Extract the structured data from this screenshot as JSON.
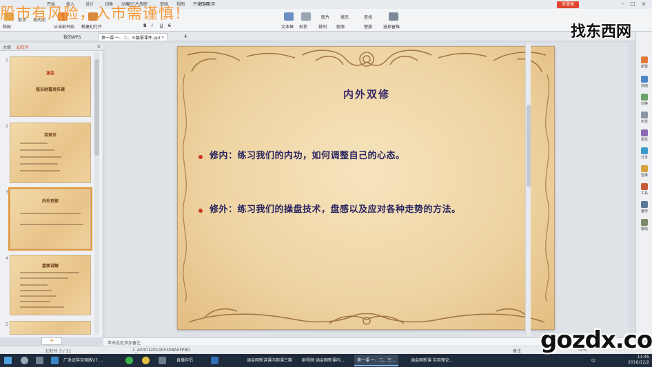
{
  "app": {
    "name": "WPS 演示",
    "login_label": "未登录"
  },
  "ribbon": {
    "tabs": [
      "开始",
      "插入",
      "设计",
      "切换",
      "动画",
      "幻灯片放映",
      "审阅",
      "视图",
      "开发工具",
      "特色应用"
    ],
    "buttons": {
      "paste": "粘贴",
      "cut": "剪切",
      "format_painter": "格式刷",
      "from_current": "从当前开始",
      "new_slide": "新建幻灯片",
      "font_bold": "B",
      "font_italic": "I",
      "font_underline": "U",
      "font_strike": "S",
      "textbox": "文本框",
      "shape": "形状",
      "arrange": "排列",
      "outline": "轮廓",
      "picture": "图片",
      "fill": "填充",
      "find": "查找",
      "replace": "替换",
      "select_pane": "选择窗格"
    }
  },
  "doc_tabs": [
    {
      "label": "我的WPS",
      "active": false
    },
    {
      "label": "第一课 一、二、三篇幂课件.ppt *",
      "active": true
    }
  ],
  "left_panel": {
    "tabs": [
      {
        "label": "大纲",
        "active": false
      },
      {
        "label": "幻灯片",
        "active": true
      }
    ],
    "thumbs": [
      {
        "num": "1",
        "title": "涵金",
        "subtitle": "涨乐财富发布课"
      },
      {
        "num": "2",
        "title": "目录页"
      },
      {
        "num": "3",
        "title": "内外双修"
      },
      {
        "num": "4",
        "title": "盘面讲解"
      },
      {
        "num": "5",
        "title": ""
      }
    ]
  },
  "slide": {
    "title": "内外双修",
    "bullets": [
      "修内：练习我们的内功，如何调整自己的心态。",
      "修外：练习我们的操盘技术，盘感以及应对各种走势的方法。"
    ]
  },
  "right_pane": {
    "items": [
      "新建",
      "动画",
      "切换",
      "形状",
      "属性",
      "分享",
      "智推",
      "工具",
      "备份",
      "帮助"
    ]
  },
  "notes": {
    "placeholder": "单击此处添加备注"
  },
  "status": {
    "slide_count": "幻灯片 3 / 11",
    "file_code": "1_A0001201405308A0FPBG",
    "notes_label": "备注",
    "zoom": "72%"
  },
  "taskbar": {
    "items": [
      {
        "label": "广发证券至强版V7....",
        "active": false
      },
      {
        "label": "直播伴侣",
        "active": false
      },
      {
        "label": "涵金网新讲课内部课三期",
        "active": false
      },
      {
        "label": "群视频 涵金网新课内...",
        "active": false
      },
      {
        "label": "第一课 一、二、三...",
        "active": true
      },
      {
        "label": "涵金网新课 实用理论...",
        "active": false
      }
    ],
    "clock_time": "11:45",
    "clock_date": "2016/12/2",
    "ime": "中"
  },
  "overlays": {
    "warning": "股市有风险，入市需谨慎！",
    "site_top": "找东西网",
    "site_bottom": "gozdx.com"
  },
  "colors": {
    "accent": "#d9421f",
    "slide_title": "#3a2a6a",
    "bullet_text": "#2a2560",
    "warning": "#f39a3a"
  }
}
